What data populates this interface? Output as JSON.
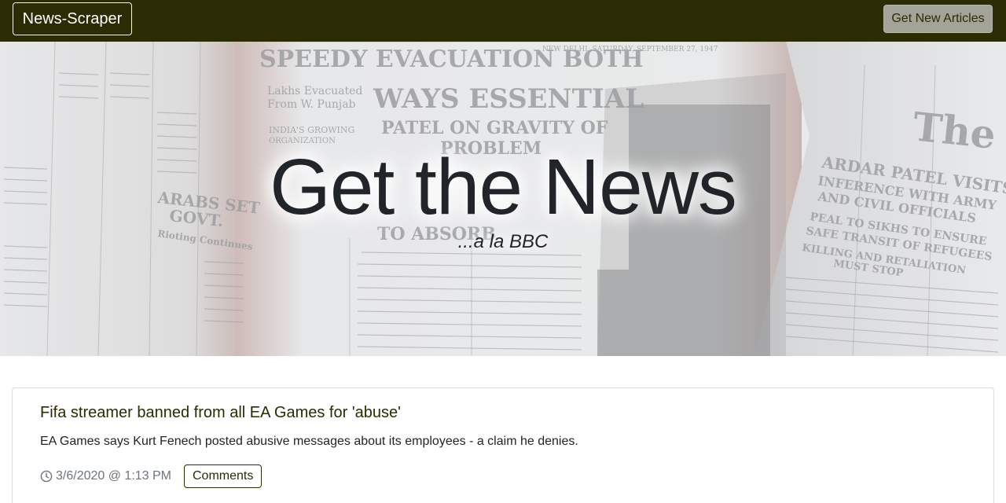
{
  "navbar": {
    "brand": "News-Scraper",
    "get_articles_label": "Get New Articles"
  },
  "hero": {
    "title": "Get the News",
    "subtitle": "...a la BBC",
    "background_text": {
      "headline_1": "SPEEDY EVACUATION BOTH",
      "headline_2": "WAYS ESSENTIAL",
      "headline_3": "PATEL ON GRAVITY OF",
      "headline_4": "PROBLEM",
      "headline_5": "TO ABSORB",
      "dateline": "NEW DELHI, SATURDAY, SEPTEMBER 27, 1947",
      "left_1": "Lakhs Evacuated",
      "left_2": "From W. Punjab",
      "left_3": "INDIA'S GROWING",
      "left_4": "ORGANIZATION",
      "left_5": "ARABS SET",
      "left_6": "GOVT.",
      "left_7": "Rioting Continues",
      "right_1": "The H",
      "right_2": "ARDAR PATEL VISITS",
      "right_3": "INFERENCE WITH ARMY",
      "right_4": "AND CIVIL OFFICIALS",
      "right_5": "PEAL TO SIKHS TO ENSURE",
      "right_6": "SAFE TRANSIT OF REFUGEES",
      "right_7": "KILLING AND RETALIATION",
      "right_8": "MUST STOP"
    }
  },
  "articles": [
    {
      "title": "Fifa streamer banned from all EA Games for 'abuse'",
      "summary": "EA Games says Kurt Fenech posted abusive messages about its employees - a claim he denies.",
      "timestamp": "3/6/2020 @ 1:13 PM",
      "comments_label": "Comments"
    }
  ],
  "colors": {
    "navbar_bg": "#2b2b04",
    "button_bg": "#a3a398",
    "text": "#212529",
    "muted": "#6c757d"
  }
}
